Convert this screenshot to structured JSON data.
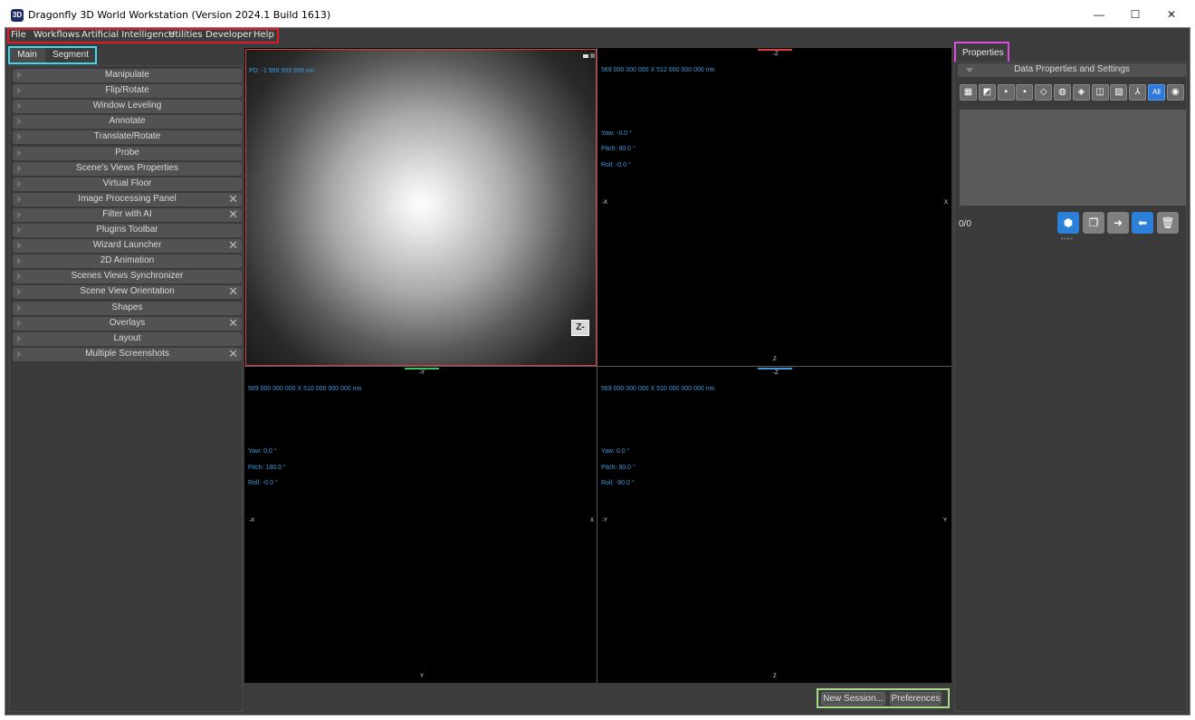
{
  "window": {
    "app_icon": "3D",
    "title": "Dragonfly 3D World Workstation (Version 2024.1 Build 1613)",
    "minimize": "—",
    "maximize": "☐",
    "close": "✕"
  },
  "menu": {
    "items": [
      "File",
      "Workflows",
      "Artificial Intelligence",
      "Utilities",
      "Developer",
      "Help"
    ]
  },
  "tabs": {
    "main": "Main",
    "segment": "Segment"
  },
  "left_panel": {
    "close_glyph": "✕",
    "items": [
      {
        "label": "Manipulate",
        "closable": false
      },
      {
        "label": "Flip/Rotate",
        "closable": false
      },
      {
        "label": "Window Leveling",
        "closable": false
      },
      {
        "label": "Annotate",
        "closable": false
      },
      {
        "label": "Translate/Rotate",
        "closable": false
      },
      {
        "label": "Probe",
        "closable": false
      },
      {
        "label": "Scene's Views Properties",
        "closable": false
      },
      {
        "label": "Virtual Floor",
        "closable": false
      },
      {
        "label": "Image Processing Panel",
        "closable": true
      },
      {
        "label": "Filter with AI",
        "closable": true
      },
      {
        "label": "Plugins Toolbar",
        "closable": false
      },
      {
        "label": "Wizard Launcher",
        "closable": true
      },
      {
        "label": "2D Animation",
        "closable": false
      },
      {
        "label": "Scenes Views Synchronizer",
        "closable": false
      },
      {
        "label": "Scene View Orientation",
        "closable": true
      },
      {
        "label": "Shapes",
        "closable": false
      },
      {
        "label": "Overlays",
        "closable": true
      },
      {
        "label": "Layout",
        "closable": false
      },
      {
        "label": "Multiple Screenshots",
        "closable": true
      }
    ]
  },
  "viewports": {
    "v1": {
      "pd": "PD: -1 999 999 999 nm",
      "cube": "Z-"
    },
    "v2": {
      "size": "569 000 000 000 X 512 000 000 000 nm",
      "yaw": "Yaw: -0.0 °",
      "pitch": "Pitch: 90.0 °",
      "roll": "Roll: -0.0 °",
      "top": "-Z",
      "bottom": "Z",
      "left": "-X",
      "right": "X"
    },
    "v3": {
      "size": "569 000 000 000 X 510 000 000 000 nm",
      "yaw": "Yaw: 0.0 °",
      "pitch": "Pitch: 180.0 °",
      "roll": "Roll: -0.0 °",
      "top": "-Y",
      "bottom": "Y",
      "left": "-X",
      "right": "X"
    },
    "v4": {
      "size": "569 000 000 000 X 510 000 000 000 nm",
      "yaw": "Yaw: 0.0 °",
      "pitch": "Pitch: 90.0 °",
      "roll": "Roll: -90.0 °",
      "top": "-Z",
      "bottom": "Z",
      "left": "-Y",
      "right": "Y"
    }
  },
  "bottom_buttons": {
    "new_session": "New Session...",
    "preferences": "Preferences"
  },
  "properties": {
    "title": "Properties",
    "section": "Data Properties and Settings",
    "toolbar_icons": [
      "grid-icon",
      "range-icon",
      "square-icon",
      "grid-small-icon",
      "diamond-icon",
      "sphere-icon",
      "layers-icon",
      "bounds-icon",
      "hatch-icon",
      "skeleton-icon",
      "All",
      "eye-icon"
    ],
    "toolbar_glyphs": [
      "▦",
      "◩",
      "▪",
      "▪",
      "◇",
      "◍",
      "◈",
      "◫",
      "▨",
      "⅄",
      "All",
      "◉"
    ],
    "count": "0/0",
    "dots": "••••"
  },
  "colors": {
    "highlight_red": "#e0192b",
    "highlight_cyan": "#3ed8ef",
    "highlight_green": "#a6dd8c",
    "highlight_magenta": "#d94fe0",
    "viewport_text": "#3f9bde",
    "accent_blue": "#2c80d8"
  }
}
